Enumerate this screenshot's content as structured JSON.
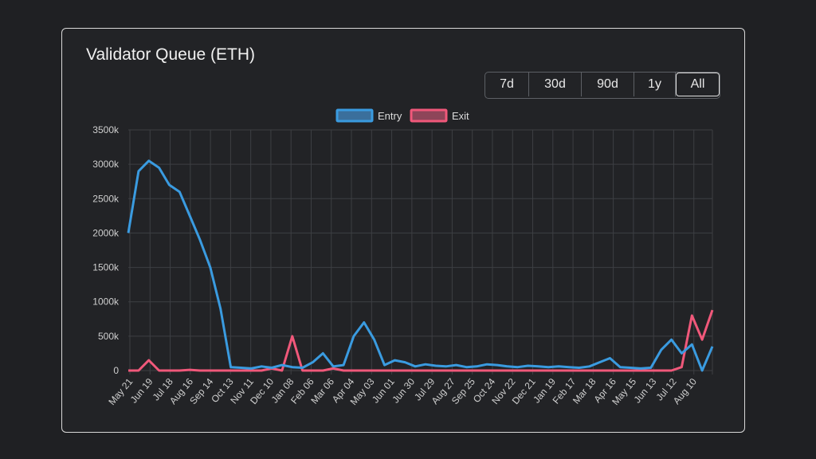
{
  "colors": {
    "entry": "#3a9be0",
    "exit": "#f0587a",
    "grid": "#3d3f43"
  },
  "card": {
    "title": "Validator Queue (ETH)"
  },
  "range_buttons": [
    {
      "label": "7d",
      "active": false
    },
    {
      "label": "30d",
      "active": false
    },
    {
      "label": "90d",
      "active": false
    },
    {
      "label": "1y",
      "active": false
    },
    {
      "label": "All",
      "active": true
    }
  ],
  "chart_data": {
    "type": "line",
    "legend": [
      "Entry",
      "Exit"
    ],
    "legend_position": "top-center",
    "grid": true,
    "ylim": [
      0,
      3500000
    ],
    "y_ticks": [
      "0",
      "500k",
      "1000k",
      "1500k",
      "2000k",
      "2500k",
      "3000k",
      "3500k"
    ],
    "x_ticks": [
      "May 21",
      "Jun 19",
      "Jul 18",
      "Aug 16",
      "Sep 14",
      "Oct 13",
      "Nov 11",
      "Dec 10",
      "Jan 08",
      "Feb 06",
      "Mar 06",
      "Apr 04",
      "May 03",
      "Jun 01",
      "Jun 30",
      "Jul 29",
      "Aug 27",
      "Sep 25",
      "Oct 24",
      "Nov 22",
      "Dec 21",
      "Jan 19",
      "Feb 17",
      "Mar 18",
      "Apr 16",
      "May 15",
      "Jun 13",
      "Jul 12",
      "Aug 10"
    ],
    "x": [
      "May 21",
      "Jun 04",
      "Jun 19",
      "Jul 04",
      "Jul 18",
      "Aug 02",
      "Aug 16",
      "Aug 31",
      "Sep 14",
      "Sep 29",
      "Oct 13",
      "Oct 28",
      "Nov 11",
      "Nov 26",
      "Dec 10",
      "Dec 25",
      "Jan 08",
      "Jan 23",
      "Feb 06",
      "Feb 20",
      "Mar 06",
      "Mar 21",
      "Apr 04",
      "Apr 19",
      "May 03",
      "May 18",
      "Jun 01",
      "Jun 16",
      "Jun 30",
      "Jul 15",
      "Jul 29",
      "Aug 13",
      "Aug 27",
      "Sep 11",
      "Sep 25",
      "Oct 10",
      "Oct 24",
      "Nov 08",
      "Nov 22",
      "Dec 07",
      "Dec 21",
      "Jan 05",
      "Jan 19",
      "Feb 03",
      "Feb 17",
      "Mar 04",
      "Mar 18",
      "Apr 02",
      "Apr 16",
      "May 01",
      "May 15",
      "May 30",
      "Jun 13",
      "Jun 28",
      "Jul 12",
      "Jul 27",
      "Aug 10",
      "Aug 18"
    ],
    "series": [
      {
        "name": "Entry",
        "values": [
          2000000,
          2900000,
          3050000,
          2950000,
          2700000,
          2600000,
          2250000,
          1900000,
          1500000,
          900000,
          50000,
          40000,
          30000,
          60000,
          40000,
          80000,
          50000,
          40000,
          120000,
          250000,
          60000,
          80000,
          500000,
          700000,
          450000,
          80000,
          150000,
          120000,
          60000,
          90000,
          70000,
          60000,
          80000,
          50000,
          60000,
          90000,
          80000,
          60000,
          50000,
          70000,
          60000,
          50000,
          60000,
          50000,
          40000,
          60000,
          120000,
          180000,
          50000,
          40000,
          30000,
          40000,
          300000,
          450000,
          250000,
          380000,
          0,
          350000
        ]
      },
      {
        "name": "Exit",
        "values": [
          0,
          0,
          150000,
          0,
          0,
          0,
          10000,
          0,
          0,
          0,
          0,
          0,
          0,
          0,
          30000,
          0,
          500000,
          0,
          0,
          0,
          30000,
          0,
          0,
          0,
          0,
          0,
          0,
          0,
          0,
          0,
          0,
          0,
          0,
          0,
          0,
          0,
          0,
          0,
          0,
          0,
          0,
          0,
          0,
          0,
          0,
          0,
          0,
          0,
          0,
          0,
          0,
          0,
          0,
          0,
          50000,
          800000,
          450000,
          880000
        ]
      }
    ]
  }
}
